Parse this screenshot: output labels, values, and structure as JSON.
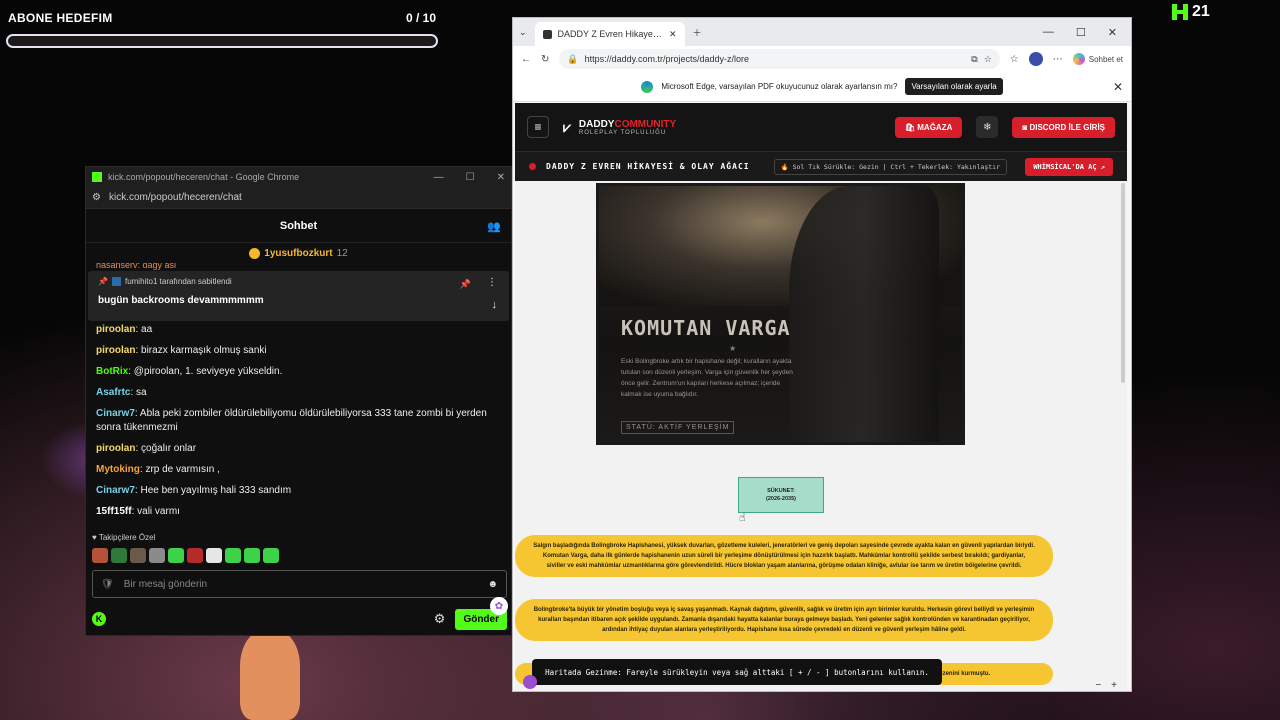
{
  "overlay": {
    "subgoal_title": "ABONE HEDEFIM",
    "subgoal_count": "0 / 10",
    "subgoal_progress": 0.0,
    "kick_count": "21"
  },
  "chat_window": {
    "title": "kick.com/popout/heceren/chat - Google Chrome",
    "address": "kick.com/popout/heceren/chat",
    "header": "Sohbet",
    "top_gifter": {
      "name": "1yusufbozkurt",
      "count": "12"
    },
    "peek_text": "hasanserv: dagy asi",
    "pinned": {
      "by": "fumihito1 tarafından sabitlendi",
      "message": "bugün backrooms devammmmmm"
    },
    "messages": [
      {
        "user": "piroolan",
        "color": "#f5d96b",
        "text": " aa"
      },
      {
        "user": "piroolan",
        "color": "#f5d96b",
        "text": " birazx karmaşık olmuş sanki"
      },
      {
        "user": "BotRix",
        "color": "#53fc18",
        "text": " @piroolan, 1. seviyeye yükseldin."
      },
      {
        "user": "Asafrtc",
        "color": "#7ad1e8",
        "text": " sa"
      },
      {
        "user": "Cinarw7",
        "color": "#7ad1e8",
        "text": " Abla peki zombiler öldürülebiliyomu öldürülebiliyorsa 333 tane zombi bi yerden sonra tükenmezmi"
      },
      {
        "user": "piroolan",
        "color": "#f5d96b",
        "text": " çoğalır onlar"
      },
      {
        "user": "Mytoking",
        "color": "#f5a33b",
        "text": " zrp de varmısın ,"
      },
      {
        "user": "Cinarw7",
        "color": "#7ad1e8",
        "text": " Hee ben yayılmış hali 333 sandım"
      },
      {
        "user": "15ff15ff",
        "color": "#ffffff",
        "text": " vali varmı"
      }
    ],
    "followers_label": "Takipçilere Özel",
    "input_placeholder": "Bir mesaj gönderin",
    "send_label": "Gönder"
  },
  "browser": {
    "tab_title": "DADDY Z Evren Hikayesi & Whimsical",
    "url": "https://daddy.com.tr/projects/daddy-z/lore",
    "copilot_label": "Sohbet et",
    "info_text": "Microsoft Edge, varsayılan PDF okuyucunuz olarak ayarlansın mı?",
    "info_button": "Varsayılan olarak ayarla"
  },
  "site": {
    "brand_main": "DADDY",
    "brand_accent": "COMMUNITY",
    "brand_sub": "ROLEPLAY TOPLULUĞU",
    "store_label": "MAĞAZA",
    "discord_label": "DISCORD İLE GİRİŞ",
    "sub_title": "DADDY Z EVREN HİKAYESİ & OLAY AĞACI",
    "sub_hint": "Sol Tık Sürükle: Gezin | Ctrl + Tekerlek: Yakınlaştır",
    "whim_label": "WHİMSİCAL'DA AÇ",
    "poster": {
      "title": "KOMUTAN VARGA",
      "body": "Eski Bolingbroke artık bir hapishane değil; kuralların ayakta tutulan son düzenli yerleşim. Varga için güvenlik her şeyden önce gelir. Zentrum'un kapıları herkese açılmaz; içeride kalmak ise uyuma bağlıdır.",
      "status": "STATÜ: AKTİF YERLEŞİM"
    },
    "node": {
      "line1": "SÜKUNET:",
      "line2": "(2026-2035)"
    },
    "paragraphs": [
      "Salgın başladığında Bolingbroke Hapishanesi, yüksek duvarları, gözetleme kuleleri, jeneratörleri ve geniş depoları sayesinde çevrede ayakta kalan en güvenli yapılardan biriydi. Komutan Varga, daha ilk günlerde hapishanenin uzun süreli bir yerleşime dönüştürülmesi için hazırlık başlattı. Mahkûmlar kontrollü şekilde serbest bırakıldı; gardiyanlar, siviller ve eski mahkûmlar uzmanlıklarına göre görevlendirildi. Hücre blokları yaşam alanlarına, görüşme odaları kliniğe, avlular ise tarım ve üretim bölgelerine çevrildi.",
      "Bolingbroke'ta büyük bir yönetim boşluğu veya iç savaş yaşanmadı. Kaynak dağıtımı, güvenlik, sağlık ve üretim için ayrı birimler kuruldu. Herkesin görevi belliydi ve yerleşimin kuralları başından itibaren açık şekilde uygulandı. Zamanla dışarıdaki hayatta kalanlar buraya gelmeye başladı. Yeni gelenler sağlık kontrolünden ve karantinadan geçiriliyor, ardından ihtiyaç duyulan alanlara yerleştiriliyordu. Hapishane kısa sürede çevredeki en düzenli ve güvenli yerleşim hâline geldi.",
      "Es merkezi olmasını temsil eden Zentrum oldu. Zentrum'un kalbinin ardından düzen kurmadı. Kaos daha kapısına ulaşmadan düzenini kurmuştu."
    ],
    "toast": "Haritada Gezinme: Fareyle sürükleyin veya sağ alttaki [ + / - ] butonlarını kullanın.",
    "zoom_minus": "−",
    "zoom_plus": "+"
  }
}
